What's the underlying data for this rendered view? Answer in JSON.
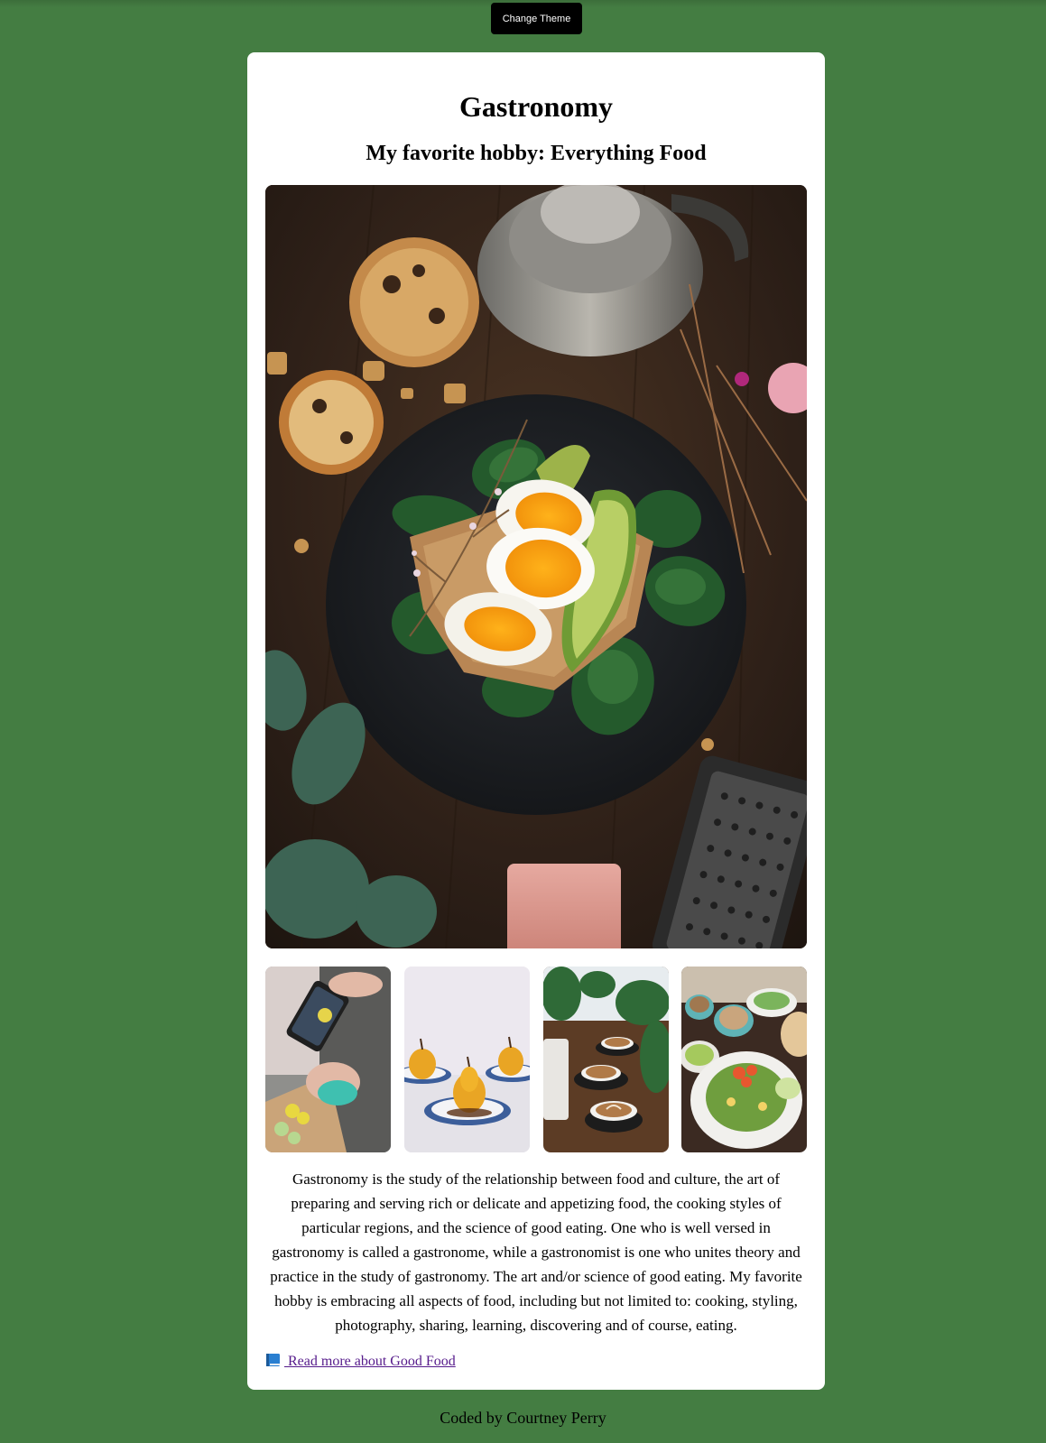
{
  "header": {
    "theme_button_label": "Change Theme"
  },
  "card": {
    "title": "Gastronomy",
    "subtitle": "My favorite hobby: Everything Food",
    "hero_image_icon": "food-photo-image",
    "gallery": [
      {
        "icon": "phone-photography-image"
      },
      {
        "icon": "poached-pears-image"
      },
      {
        "icon": "latte-cups-image"
      },
      {
        "icon": "salad-table-image"
      }
    ],
    "description": "Gastronomy is the study of the relationship between food and culture, the art of preparing and serving rich or delicate and appetizing food, the cooking styles of particular regions, and the science of good eating. One who is well versed in gastronomy is called a gastronome, while a gastronomist is one who unites theory and practice in the study of gastronomy. The art and/or science of good eating. My favorite hobby is embracing all aspects of food, including but not limited to: cooking, styling, photography, sharing, learning, discovering and of course, eating.",
    "read_more_icon": "book-icon",
    "read_more_label": " Read more about Good Food"
  },
  "footer": {
    "credit": "Coded by Courtney Perry"
  },
  "colors": {
    "background": "#447d42",
    "card": "#ffffff",
    "button": "#000000",
    "link": "#551a8b"
  }
}
